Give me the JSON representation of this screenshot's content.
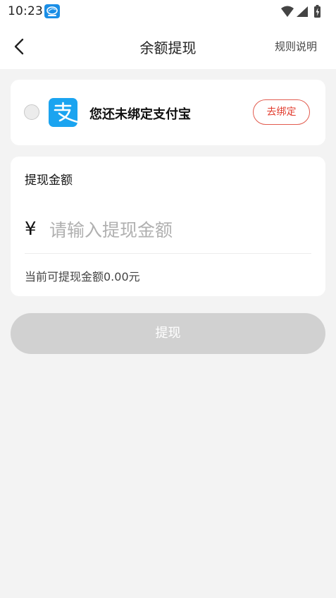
{
  "status_bar": {
    "time": "10:23",
    "icons": [
      "app-notification-icon",
      "wifi-icon",
      "cellular-signal-icon",
      "battery-charging-icon"
    ]
  },
  "header": {
    "back_icon": "chevron-left-icon",
    "title": "余额提现",
    "rules_label": "规则说明"
  },
  "alipay_card": {
    "logo_icon": "alipay-logo-icon",
    "status_text": "您还未绑定支付宝",
    "bind_label": "去绑定",
    "selected": false
  },
  "amount_card": {
    "label": "提现金额",
    "currency": "¥",
    "input_placeholder": "请输入提现金额",
    "input_value": "",
    "available_text": "当前可提现金额0.00元"
  },
  "withdraw_button": {
    "label": "提现",
    "enabled": false
  },
  "colors": {
    "accent_red": "#e23c2e",
    "alipay_blue": "#1ba4f0",
    "disabled_button": "#d1d1d1",
    "page_background": "#f3f3f3"
  }
}
